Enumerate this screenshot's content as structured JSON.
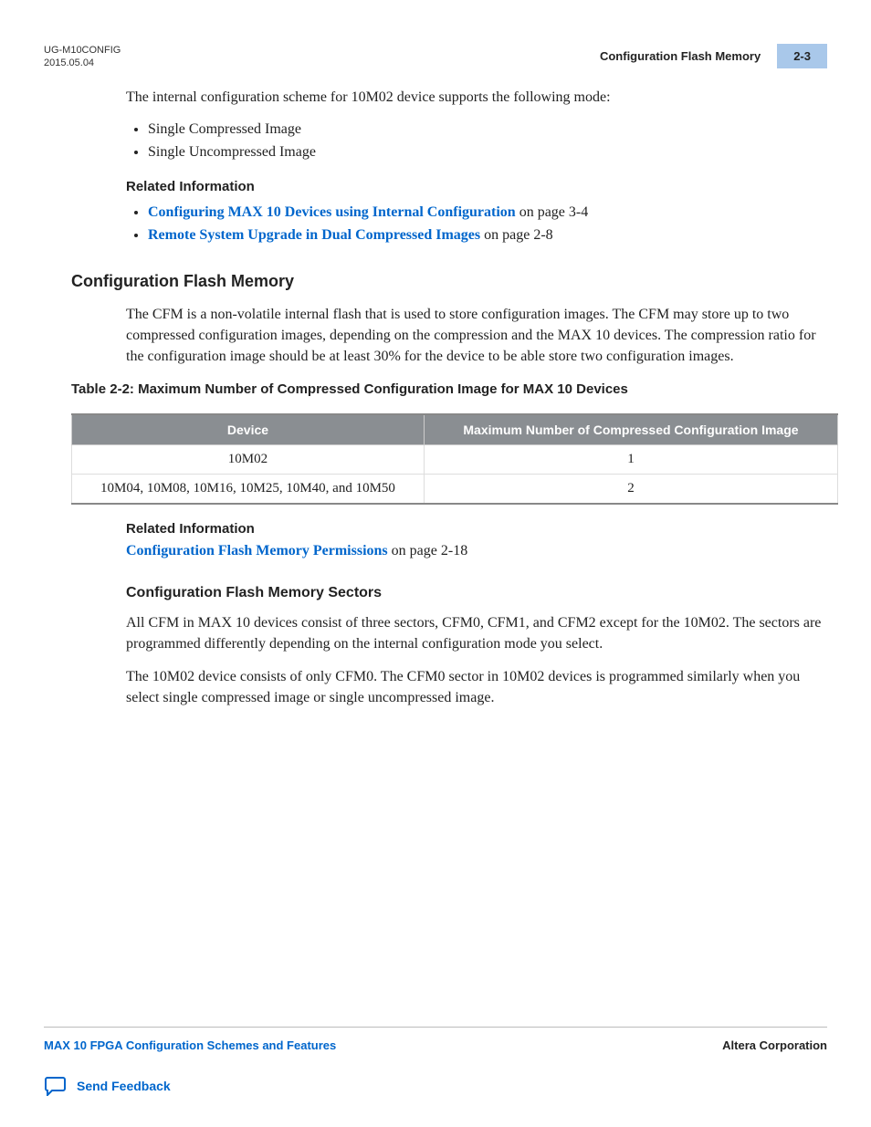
{
  "header": {
    "doc_id": "UG-M10CONFIG",
    "date": "2015.05.04",
    "title": "Configuration Flash Memory",
    "page": "2-3"
  },
  "intro_para": "The internal configuration scheme for 10M02 device supports the following mode:",
  "mode_list": [
    "Single Compressed Image",
    "Single Uncompressed Image"
  ],
  "related1_heading": "Related Information",
  "related1": [
    {
      "link": "Configuring MAX 10 Devices using Internal Configuration",
      "suffix": " on page 3-4"
    },
    {
      "link": "Remote System Upgrade in Dual Compressed Images",
      "suffix": " on page 2-8"
    }
  ],
  "section_heading": "Configuration Flash Memory",
  "cfm_para": "The CFM is a non-volatile internal flash that is used to store configuration images. The CFM may store up to two compressed configuration images, depending on the compression and the MAX 10 devices. The compression ratio for the configuration image should be at least 30% for the device to be able store two configuration images.",
  "table_caption": "Table 2-2: Maximum Number of Compressed Configuration Image for MAX 10 Devices",
  "table": {
    "headers": [
      "Device",
      "Maximum Number of Compressed Configuration Image"
    ],
    "rows": [
      [
        "10M02",
        "1"
      ],
      [
        "10M04, 10M08, 10M16, 10M25, 10M40, and 10M50",
        "2"
      ]
    ]
  },
  "related2_heading": "Related Information",
  "related2_link": "Configuration Flash Memory Permissions",
  "related2_suffix": " on page 2-18",
  "subsection_heading": "Configuration Flash Memory Sectors",
  "sectors_para1": "All CFM in MAX 10 devices consist of three sectors, CFM0, CFM1, and CFM2 except for the 10M02. The sectors are programmed differently depending on the internal configuration mode you select.",
  "sectors_para2": "The 10M02 device consists of only CFM0. The CFM0 sector in 10M02 devices is programmed similarly when you select single compressed image or single uncompressed image.",
  "footer": {
    "left": "MAX 10 FPGA Configuration Schemes and Features",
    "right": "Altera Corporation",
    "feedback": "Send Feedback"
  }
}
